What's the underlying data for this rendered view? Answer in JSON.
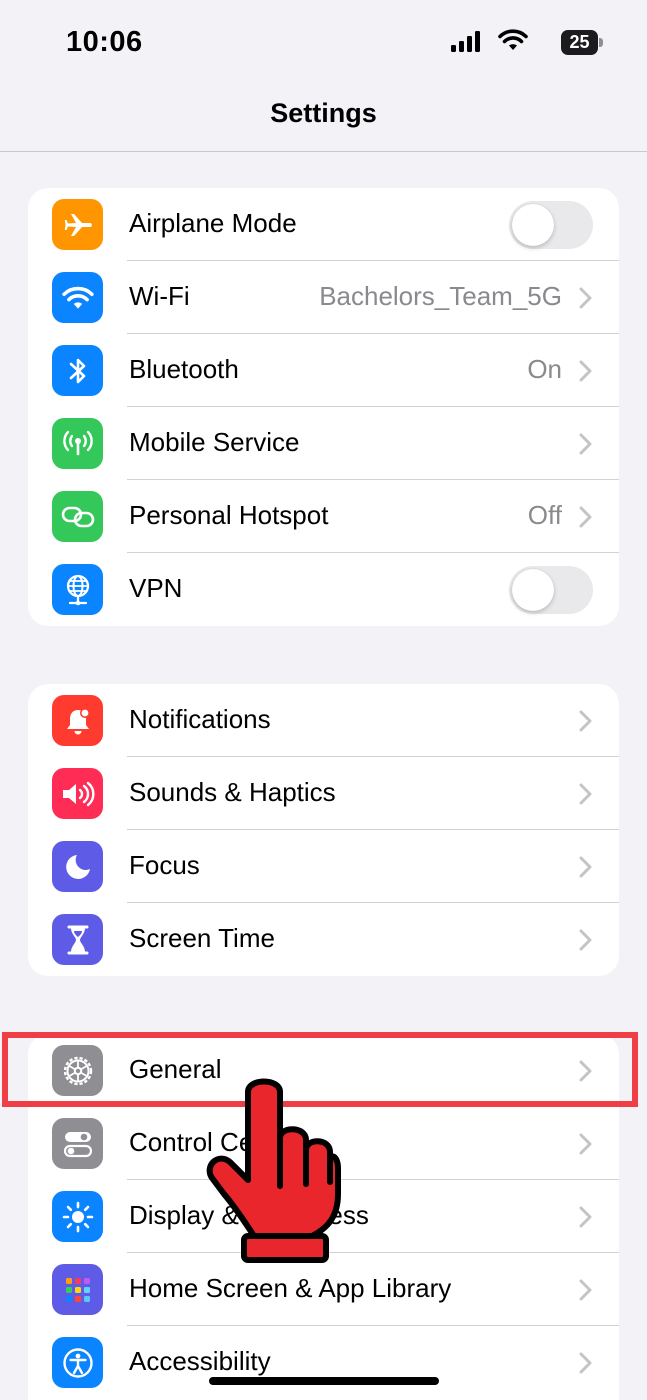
{
  "status_bar": {
    "time": "10:06",
    "battery_level": "25",
    "icons": [
      "signal-icon",
      "wifi-icon",
      "battery-icon"
    ]
  },
  "nav": {
    "title": "Settings"
  },
  "groups": [
    {
      "rows": [
        {
          "label": "Airplane Mode",
          "icon": "airplane-icon",
          "icon_color": "#ff9500",
          "control": "toggle",
          "toggle_on": false
        },
        {
          "label": "Wi-Fi",
          "icon": "wifi-icon",
          "icon_color": "#0a84ff",
          "value": "Bachelors_Team_5G",
          "control": "chevron"
        },
        {
          "label": "Bluetooth",
          "icon": "bluetooth-icon",
          "icon_color": "#0a84ff",
          "value": "On",
          "control": "chevron"
        },
        {
          "label": "Mobile Service",
          "icon": "antenna-icon",
          "icon_color": "#34c759",
          "control": "chevron"
        },
        {
          "label": "Personal Hotspot",
          "icon": "hotspot-icon",
          "icon_color": "#34c759",
          "value": "Off",
          "control": "chevron"
        },
        {
          "label": "VPN",
          "icon": "globe-icon",
          "icon_color": "#0a84ff",
          "control": "toggle",
          "toggle_on": false
        }
      ]
    },
    {
      "rows": [
        {
          "label": "Notifications",
          "icon": "bell-icon",
          "icon_color": "#ff3b30",
          "control": "chevron"
        },
        {
          "label": "Sounds & Haptics",
          "icon": "speaker-icon",
          "icon_color": "#ff2d55",
          "control": "chevron"
        },
        {
          "label": "Focus",
          "icon": "moon-icon",
          "icon_color": "#5e5ce6",
          "control": "chevron"
        },
        {
          "label": "Screen Time",
          "icon": "hourglass-icon",
          "icon_color": "#5e5ce6",
          "control": "chevron"
        }
      ]
    },
    {
      "rows": [
        {
          "label": "General",
          "icon": "gear-icon",
          "icon_color": "#8e8e93",
          "control": "chevron"
        },
        {
          "label": "Control Centre",
          "icon": "switches-icon",
          "icon_color": "#8e8e93",
          "control": "chevron"
        },
        {
          "label": "Display & Brightness",
          "icon": "sun-icon",
          "icon_color": "#0a84ff",
          "control": "chevron"
        },
        {
          "label": "Home Screen & App Library",
          "icon": "app-grid-icon",
          "icon_color": "#5e5ce6",
          "control": "chevron"
        },
        {
          "label": "Accessibility",
          "icon": "accessibility-icon",
          "icon_color": "#0a84ff",
          "control": "chevron"
        }
      ]
    }
  ],
  "overlay": {
    "highlight_color": "#f03e46",
    "highlighted_item": "General",
    "pointer": "pointing-hand-icon"
  }
}
